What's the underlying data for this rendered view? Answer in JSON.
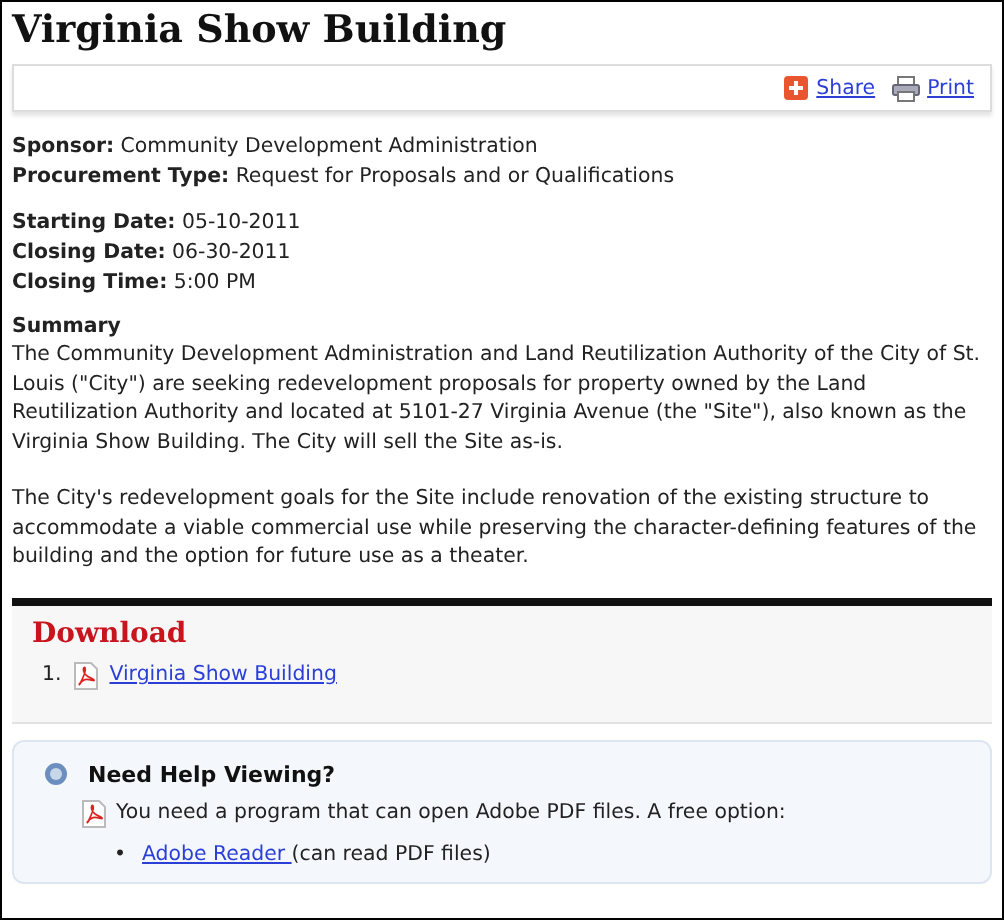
{
  "title": "Virginia Show Building",
  "toolbar": {
    "share": "Share",
    "print": "Print"
  },
  "fields": [
    {
      "text": "**Sponsor:** Community Development Administration"
    },
    {
      "text": "**Procurement Type:** Request for Proposals and or Qualifications"
    }
  ],
  "dates": [
    {
      "text": "**Starting Date:** 05-10-2011"
    },
    {
      "text": "**Closing Date:** 06-30-2011"
    },
    {
      "text": "**Closing Time:** 5:00 PM"
    }
  ],
  "summary": {
    "heading": "Summary",
    "paragraphs": [
      "The Community Development Administration and Land Reutilization Authority of the City of St. Louis (\"City\") are seeking redevelopment proposals for property owned by the Land Reutilization Authority and located at 5101-27 Virginia Avenue (the \"Site\"), also known as the Virginia Show Building. The City will sell the Site as-is.",
      "The City's redevelopment goals for the Site include renovation of the existing structure to accommodate a viable commercial use while preserving the character-defining features of the building and the option for future use as a theater."
    ]
  },
  "download": {
    "heading": "Download",
    "items": [
      {
        "number": "1.",
        "label": "Virginia Show Building"
      }
    ]
  },
  "help": {
    "heading": "Need Help Viewing?",
    "note": "You need a program that can open Adobe PDF files. A free option:",
    "bullet": "•",
    "link": "Adobe Reader ",
    "after": "(can read PDF files)"
  }
}
